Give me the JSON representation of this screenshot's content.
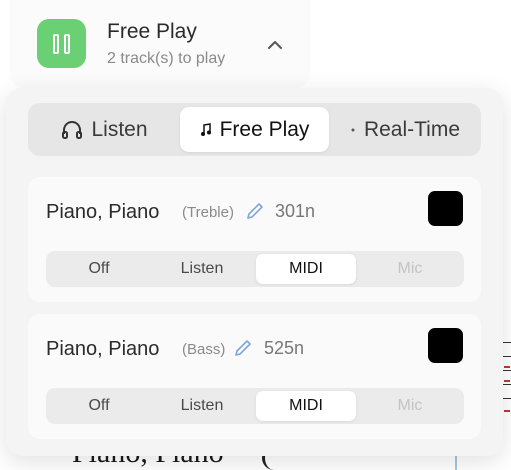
{
  "header": {
    "title": "Free Play",
    "subtitle": "2 track(s) to play",
    "play_icon": "pause-icon",
    "toggle_icon": "chevron-up-icon",
    "accent_color": "#6bcf73"
  },
  "mode_tabs": [
    {
      "label": "Listen",
      "icon": "headphones-icon",
      "active": false
    },
    {
      "label": "Free Play",
      "icon": "music-note-icon",
      "active": true
    },
    {
      "label": "Real-Time",
      "icon": "dot-icon",
      "active": false
    }
  ],
  "tracks": [
    {
      "name": "Piano, Piano",
      "clef": "(Treble)",
      "notes": "301n",
      "color": "#000000",
      "input_options": [
        "Off",
        "Listen",
        "MIDI",
        "Mic"
      ],
      "selected": "MIDI",
      "disabled": [
        "Mic"
      ]
    },
    {
      "name": "Piano, Piano",
      "clef": "(Bass)",
      "notes": "525n",
      "color": "#000000",
      "input_options": [
        "Off",
        "Listen",
        "MIDI",
        "Mic"
      ],
      "selected": "MIDI",
      "disabled": [
        "Mic"
      ]
    }
  ],
  "background": {
    "score_title": "Piano, Piano"
  }
}
